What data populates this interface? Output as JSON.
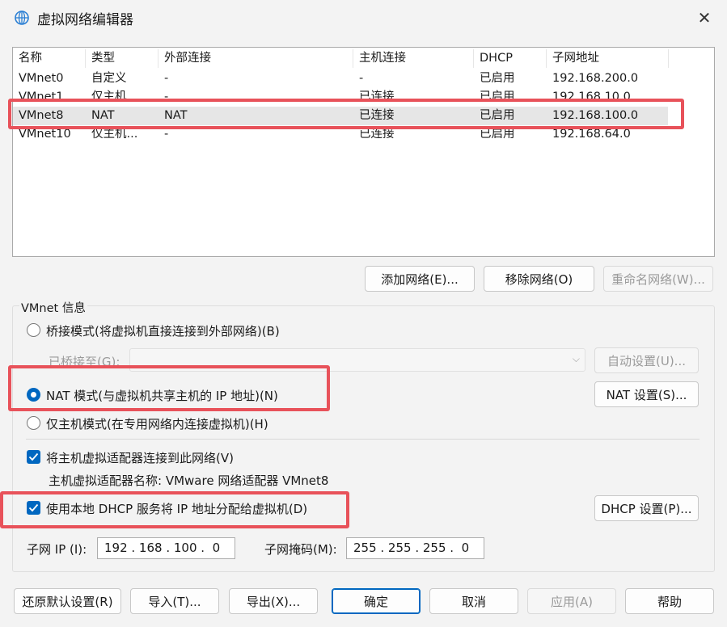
{
  "window": {
    "title": "虚拟网络编辑器",
    "close_glyph": "✕"
  },
  "network_list": {
    "columns": [
      "名称",
      "类型",
      "外部连接",
      "主机连接",
      "DHCP",
      "子网地址"
    ],
    "rows": [
      [
        "VMnet0",
        "自定义",
        "-",
        "-",
        "已启用",
        "192.168.200.0"
      ],
      [
        "VMnet1",
        "仅主机...",
        "-",
        "已连接",
        "已启用",
        "192.168.10.0"
      ],
      [
        "VMnet8",
        "NAT",
        "NAT",
        "已连接",
        "已启用",
        "192.168.100.0"
      ],
      [
        "VMnet10",
        "仅主机...",
        "-",
        "已连接",
        "已启用",
        "192.168.64.0"
      ]
    ],
    "selected_row": "VMnet8"
  },
  "network_buttons": {
    "add": "添加网络(E)...",
    "remove": "移除网络(O)",
    "rename": "重命名网络(W)..."
  },
  "vmnet_info": {
    "group_label": "VMnet 信息",
    "bridged_label": "桥接模式(将虚拟机直接连接到外部网络)(B)",
    "bridged_to_label": "已桥接至(G):",
    "bridged_to_value": "",
    "auto_settings": "自动设置(U)...",
    "nat_label": "NAT 模式(与虚拟机共享主机的 IP 地址)(N)",
    "nat_settings": "NAT 设置(S)...",
    "host_only_label": "仅主机模式(在专用网络内连接虚拟机)(H)",
    "connect_adapter_label": "将主机虚拟适配器连接到此网络(V)",
    "adapter_name_text": "主机虚拟适配器名称: VMware 网络适配器 VMnet8",
    "dhcp_label": "使用本地 DHCP 服务将 IP 地址分配给虚拟机(D)",
    "dhcp_settings": "DHCP 设置(P)...",
    "subnet_ip_label": "子网 IP (I):",
    "subnet_ip_value": "192 . 168 . 100 .  0",
    "subnet_mask_label": "子网掩码(M):",
    "subnet_mask_value": "255 . 255 . 255 .  0",
    "mode": "nat",
    "connect_adapter_checked": true,
    "dhcp_checked": true
  },
  "footer": {
    "restore": "还原默认设置(R)",
    "import": "导入(T)...",
    "export": "导出(X)...",
    "ok": "确定",
    "cancel": "取消",
    "apply": "应用(A)",
    "help": "帮助"
  },
  "colors": {
    "accent": "#0067c0",
    "highlight": "#e8525a",
    "selected_row": "#e6e6e6"
  }
}
